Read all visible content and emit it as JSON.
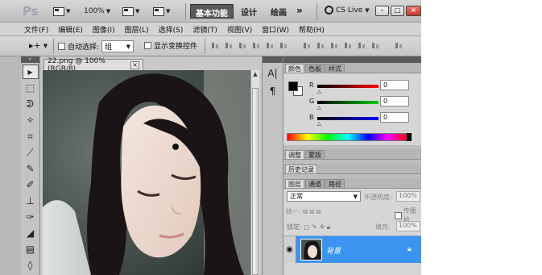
{
  "app": {
    "logo": "Ps",
    "zoom": "100%",
    "workspaces": [
      "基本功能",
      "设计",
      "绘画"
    ],
    "active_workspace": "基本功能",
    "more_chevron": "»",
    "cs_live": "CS Live"
  },
  "menu": [
    "文件(F)",
    "编辑(E)",
    "图像(I)",
    "图层(L)",
    "选择(S)",
    "滤镜(T)",
    "视图(V)",
    "窗口(W)",
    "帮助(H)"
  ],
  "options": {
    "auto_select_label": "自动选择:",
    "auto_select_value": "组",
    "show_transform_label": "显示变换控件"
  },
  "document": {
    "tab_title": "22.png @ 100%(RGB/8)",
    "close": "×"
  },
  "panels": {
    "color_tabs": [
      "颜色",
      "色板",
      "样式"
    ],
    "color": {
      "r_label": "R",
      "r_value": "0",
      "g_label": "G",
      "g_value": "0",
      "b_label": "B",
      "b_value": "0"
    },
    "adjust_tabs": [
      "调整",
      "蒙版"
    ],
    "history_tab": "历史记录",
    "layer_tabs": [
      "图层",
      "通道",
      "路径"
    ],
    "layers": {
      "blend_mode": "正常",
      "opacity_label": "不透明度:",
      "opacity_value": "100%",
      "unify_label": "统一:",
      "propagate_label": "传播帧",
      "lock_label": "锁定:",
      "fill_label": "填充:",
      "fill_value": "100%",
      "layer_name": "背景"
    }
  },
  "colors": {
    "selected_layer": "#3b94f0",
    "panel_bg": "#d6d6d6",
    "app_bg": "#c9c9c9"
  }
}
